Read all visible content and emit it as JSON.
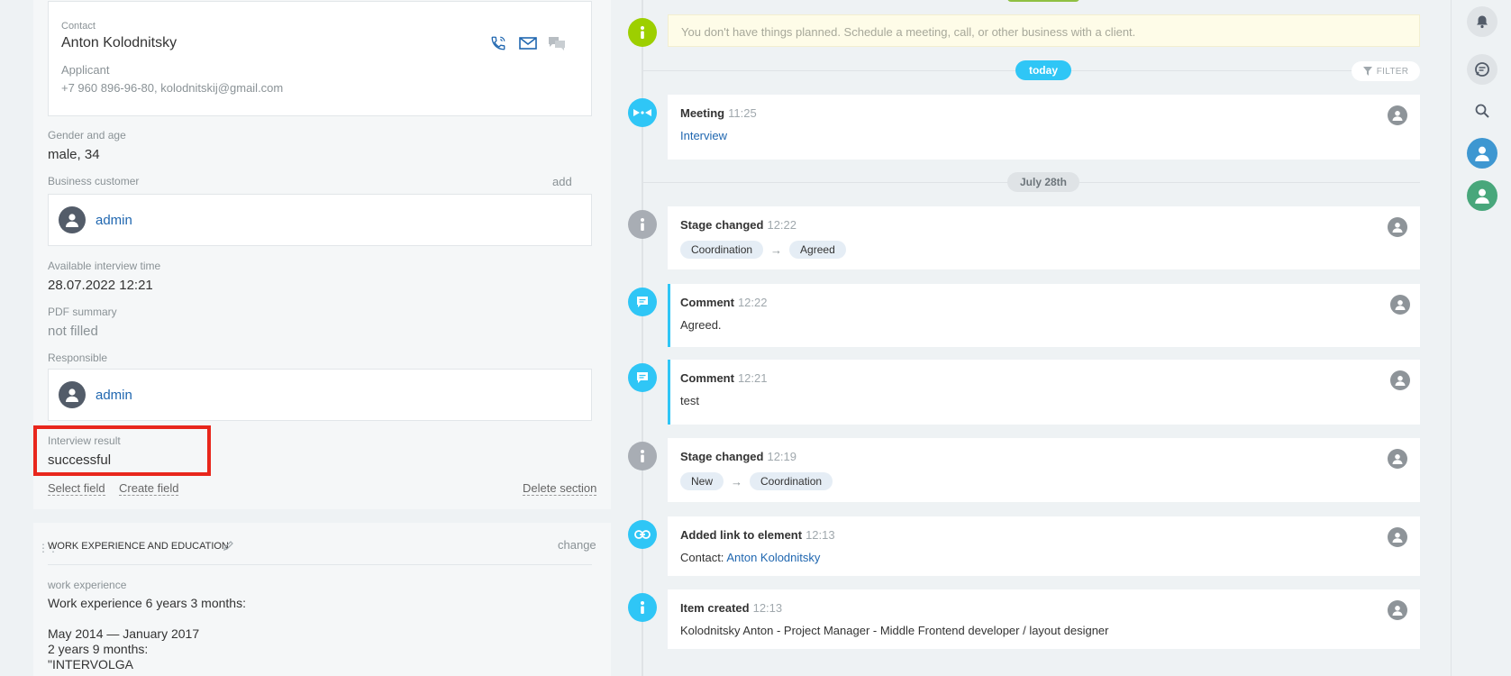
{
  "contact": {
    "label": "Contact",
    "name": "Anton Kolodnitsky",
    "role": "Applicant",
    "info": "+7 960 896-96-80, kolodnitskij@gmail.com"
  },
  "fields": {
    "gender_label": "Gender and age",
    "gender_value": "male, 34",
    "business_label": "Business customer",
    "business_add": "add",
    "business_user": "admin",
    "interview_time_label": "Available interview time",
    "interview_time_value": "28.07.2022 12:21",
    "pdf_label": "PDF summary",
    "pdf_value": "not filled",
    "responsible_label": "Responsible",
    "responsible_user": "admin",
    "result_label": "Interview result",
    "result_value": "successful"
  },
  "actions": {
    "select_field": "Select field",
    "create_field": "Create field",
    "delete_section": "Delete section"
  },
  "work_section": {
    "title": "Work experience and education",
    "change": "change",
    "label": "work experience",
    "text": "Work experience 6 years 3 months:\n\nMay 2014 — January 2017\n2 years 9 months:\n\"INTERVOLGA\n..."
  },
  "timeline": {
    "notice": "You don't have things planned. Schedule a meeting, call, or other business with a client.",
    "today_label": "today",
    "filter_label": "FILTER",
    "date_label": "July 28th",
    "meeting": {
      "title": "Meeting",
      "time": "11:25",
      "link": "Interview"
    },
    "stage1": {
      "title": "Stage changed",
      "time": "12:22",
      "from": "Coordination",
      "to": "Agreed"
    },
    "comment1": {
      "title": "Comment",
      "time": "12:22",
      "text": "Agreed."
    },
    "comment2": {
      "title": "Comment",
      "time": "12:21",
      "text": "test"
    },
    "stage2": {
      "title": "Stage changed",
      "time": "12:19",
      "from": "New",
      "to": "Coordination"
    },
    "link_added": {
      "title": "Added link to element",
      "time": "12:13",
      "prefix": "Contact:",
      "link": "Anton Kolodnitsky"
    },
    "created": {
      "title": "Item created",
      "time": "12:13",
      "text": "Kolodnitsky Anton - Project Manager - Middle Frontend developer / layout designer"
    },
    "arrow": "→"
  },
  "colors": {
    "accent_blue": "#2fc6f6",
    "link_blue": "#2067b0",
    "highlight_red": "#e8261c",
    "info_green": "#9dcf00"
  },
  "icons": {
    "sidebar": [
      "bell-icon",
      "chat-icon",
      "search-icon",
      "user-avatar-icon",
      "user-avatar-icon"
    ]
  }
}
